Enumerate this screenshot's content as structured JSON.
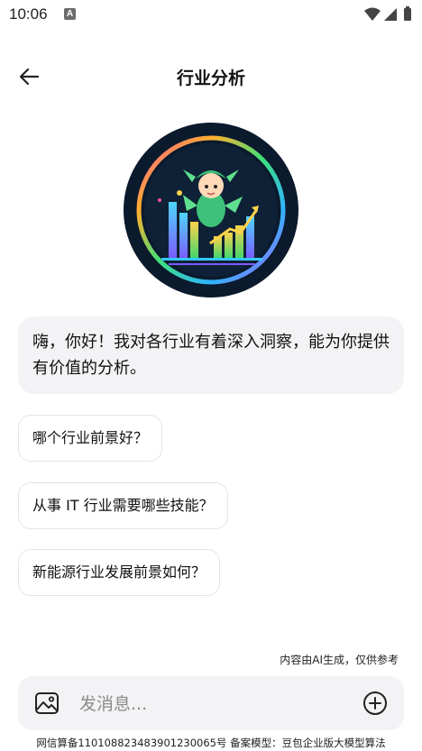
{
  "status_bar": {
    "time": "10:06",
    "notification_icon": "A"
  },
  "header": {
    "title": "行业分析",
    "back_icon": "arrow-left-icon"
  },
  "greeting": {
    "text": "嗨，你好！我对各行业有着深入洞察，能为你提供有价值的分析。"
  },
  "suggestions": [
    "哪个行业前景好？",
    "从事 IT 行业需要哪些技能？",
    "新能源行业发展前景如何？"
  ],
  "disclaimer": "内容由AI生成，仅供参考",
  "input": {
    "placeholder": "发消息...",
    "value": ""
  },
  "footer": "网信算备110108823483901230065号 备案模型：豆包企业版大模型算法",
  "colors": {
    "bubble_bg": "#f3f3f5",
    "border": "#e4e4e4",
    "avatar_bg": "#0b1a2c"
  }
}
